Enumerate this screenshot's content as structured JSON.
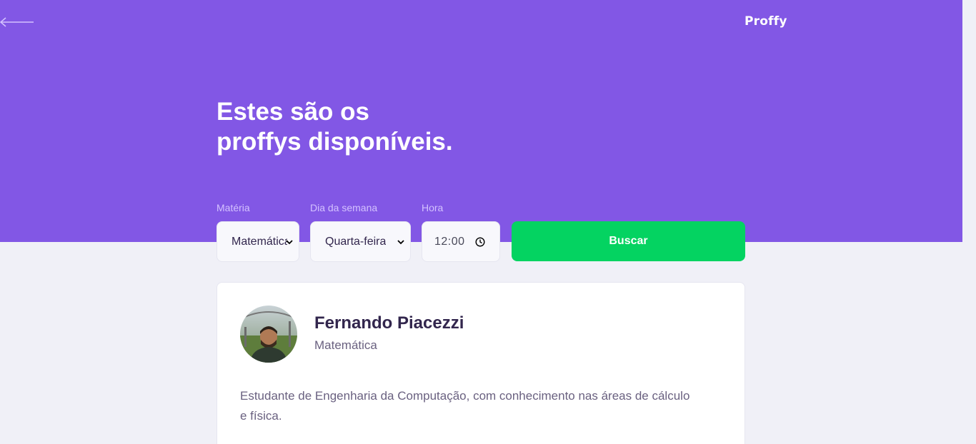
{
  "header": {
    "logo": "Proffy",
    "title_line1": "Estes são os",
    "title_line2": "proffys disponíveis."
  },
  "filters": {
    "subject": {
      "label": "Matéria",
      "value": "Matemática"
    },
    "weekday": {
      "label": "Dia da semana",
      "value": "Quarta-feira"
    },
    "time": {
      "label": "Hora",
      "value": "12:00"
    },
    "search_label": "Buscar"
  },
  "teacher": {
    "name": "Fernando Piacezzi",
    "subject": "Matemática",
    "bio": "Estudante de Engenharia da Computação, com conhecimento nas áreas de cálculo e física."
  },
  "colors": {
    "primary": "#8257e5",
    "secondary": "#04d361",
    "background": "#f0f0f7"
  },
  "icons": {
    "back": "arrow-left-icon",
    "select": "chevron-down-icon",
    "time": "clock-icon"
  }
}
